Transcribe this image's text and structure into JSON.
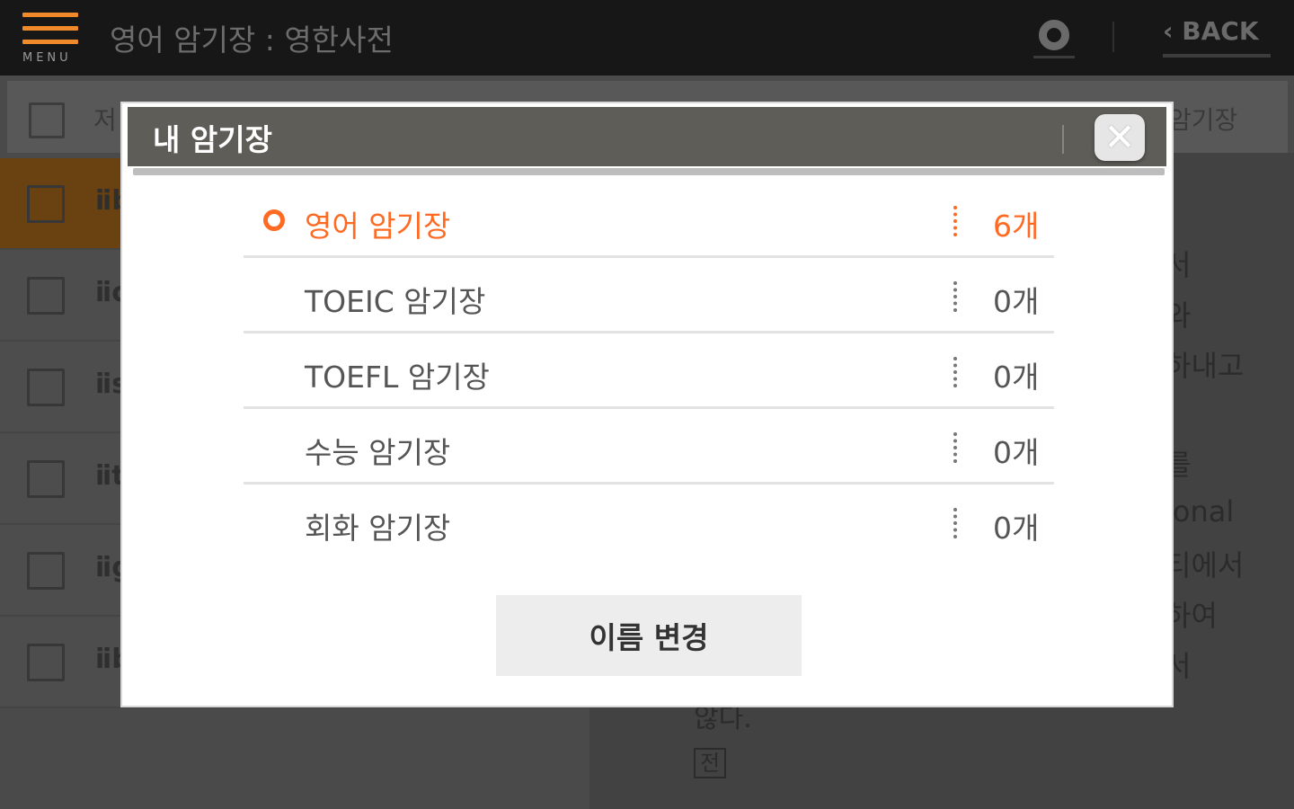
{
  "header": {
    "menu_label": "MENU",
    "title": "영어 암기장 : 영한사전",
    "back_label": "‹ BACK"
  },
  "list": {
    "header_label": "저",
    "header_right": "암기장",
    "rows": [
      {
        "word": "ⅱb",
        "active": true
      },
      {
        "word": "ⅱc",
        "active": false
      },
      {
        "word": "ⅱs",
        "active": false
      },
      {
        "word": "ⅱt",
        "active": false
      },
      {
        "word": "ⅱg",
        "active": false
      },
      {
        "word": "ⅱb",
        "active": false
      }
    ]
  },
  "detail": {
    "lines": [
      "서",
      "와",
      "하내고",
      "를",
      "ional",
      "티에서",
      "하여",
      "서"
    ],
    "bottom_text": "않다.",
    "box_char": "전"
  },
  "modal": {
    "title": "내 암기장",
    "close_icon": "close-icon",
    "items": [
      {
        "name": "영어 암기장",
        "count": "6개",
        "selected": true
      },
      {
        "name": "TOEIC 암기장",
        "count": "0개",
        "selected": false
      },
      {
        "name": "TOEFL 암기장",
        "count": "0개",
        "selected": false
      },
      {
        "name": "수능 암기장",
        "count": "0개",
        "selected": false
      },
      {
        "name": "회화 암기장",
        "count": "0개",
        "selected": false
      }
    ],
    "rename_label": "이름 변경"
  },
  "colors": {
    "accent": "#ff6a22",
    "menu_accent": "#f08a2a",
    "modal_header": "#5e5d58"
  }
}
